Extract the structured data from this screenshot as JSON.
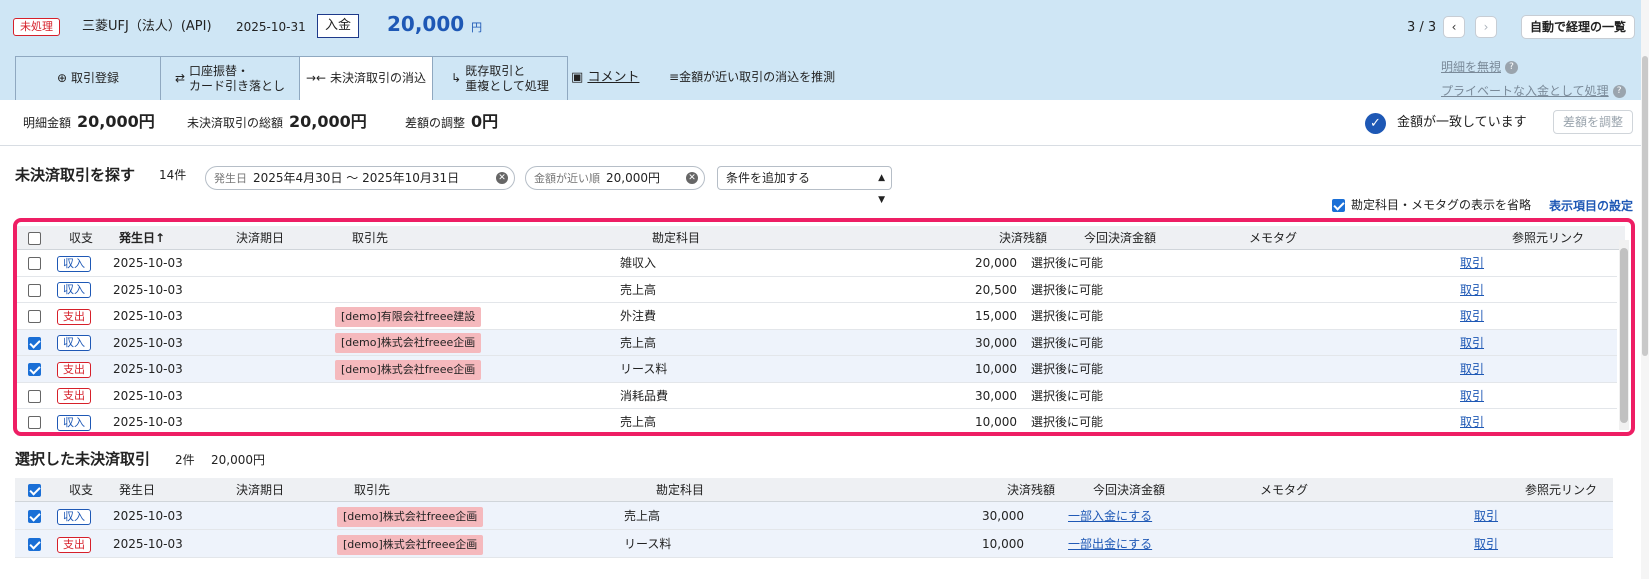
{
  "header": {
    "status": "未処理",
    "bank": "三菱UFJ（法人）(API)",
    "date": "2025-10-31",
    "type": "入金",
    "amount": "20,000",
    "currency": "円",
    "pager": "3 / 3",
    "auto_button": "自動で経理の一覧"
  },
  "tabs": {
    "register": "取引登録",
    "transfer_line1": "口座振替・",
    "transfer_line2": "カード引き落とし",
    "reconcile": "未決済取引の消込",
    "existing_line1": "既存取引と",
    "existing_line2": "重複として処理",
    "comment": "コメント",
    "suggest": "金額が近い取引の消込を推測"
  },
  "side_links": {
    "ignore": "明細を無視",
    "private": "プライベートな入金として処理"
  },
  "summary": {
    "detail_label": "明細金額",
    "detail_value": "20,000円",
    "total_label": "未決済取引の総額",
    "total_value": "20,000円",
    "diff_label": "差額の調整",
    "diff_value": "0円",
    "match_text": "金額が一致しています",
    "adjust_button": "差額を調整"
  },
  "search": {
    "title": "未決済取引を探す",
    "count": "14件",
    "date_key": "発生日",
    "date_value": "2025年4月30日 〜 2025年10月31日",
    "amount_key": "金額が近い順",
    "amount_value": "20,000円",
    "condition": "条件を追加する",
    "omit_label": "勘定科目・メモタグの表示を省略",
    "display_settings": "表示項目の設定"
  },
  "table": {
    "headers": {
      "kind": "収支",
      "date": "発生日",
      "due": "決済期日",
      "partner": "取引先",
      "account": "勘定科目",
      "balance": "決済残額",
      "current": "今回決済金額",
      "memo": "メモタグ",
      "ref": "参照元リンク"
    },
    "sort_arrow": "↑",
    "rows": [
      {
        "kind": "収入",
        "date": "2025-10-03",
        "partner": "",
        "account": "雑収入",
        "balance": "20,000",
        "current": "選択後に可能",
        "ref": "取引"
      },
      {
        "kind": "収入",
        "date": "2025-10-03",
        "partner": "",
        "account": "売上高",
        "balance": "20,500",
        "current": "選択後に可能",
        "ref": "取引"
      },
      {
        "kind": "支出",
        "date": "2025-10-03",
        "partner": "[demo]有限会社freee建設",
        "account": "外注費",
        "balance": "15,000",
        "current": "選択後に可能",
        "ref": "取引"
      },
      {
        "kind": "収入",
        "date": "2025-10-03",
        "partner": "[demo]株式会社freee企画",
        "account": "売上高",
        "balance": "30,000",
        "current": "選択後に可能",
        "ref": "取引"
      },
      {
        "kind": "支出",
        "date": "2025-10-03",
        "partner": "[demo]株式会社freee企画",
        "account": "リース料",
        "balance": "10,000",
        "current": "選択後に可能",
        "ref": "取引"
      },
      {
        "kind": "支出",
        "date": "2025-10-03",
        "partner": "",
        "account": "消耗品費",
        "balance": "30,000",
        "current": "選択後に可能",
        "ref": "取引"
      },
      {
        "kind": "収入",
        "date": "2025-10-03",
        "partner": "",
        "account": "売上高",
        "balance": "10,000",
        "current": "選択後に可能",
        "ref": "取引"
      }
    ]
  },
  "selected": {
    "title": "選択した未決済取引",
    "count": "2件",
    "total": "20,000円",
    "rows": [
      {
        "kind": "収入",
        "date": "2025-10-03",
        "partner": "[demo]株式会社freee企画",
        "account": "売上高",
        "balance": "30,000",
        "current": "一部入金にする",
        "ref": "取引"
      },
      {
        "kind": "支出",
        "date": "2025-10-03",
        "partner": "[demo]株式会社freee企画",
        "account": "リース料",
        "balance": "10,000",
        "current": "一部出金にする",
        "ref": "取引"
      }
    ]
  },
  "colors": {
    "accent": "#1e58b5",
    "highlight": "#ee1e64",
    "expense": "#d6202a",
    "partner_tag": "#f5b9bd"
  }
}
